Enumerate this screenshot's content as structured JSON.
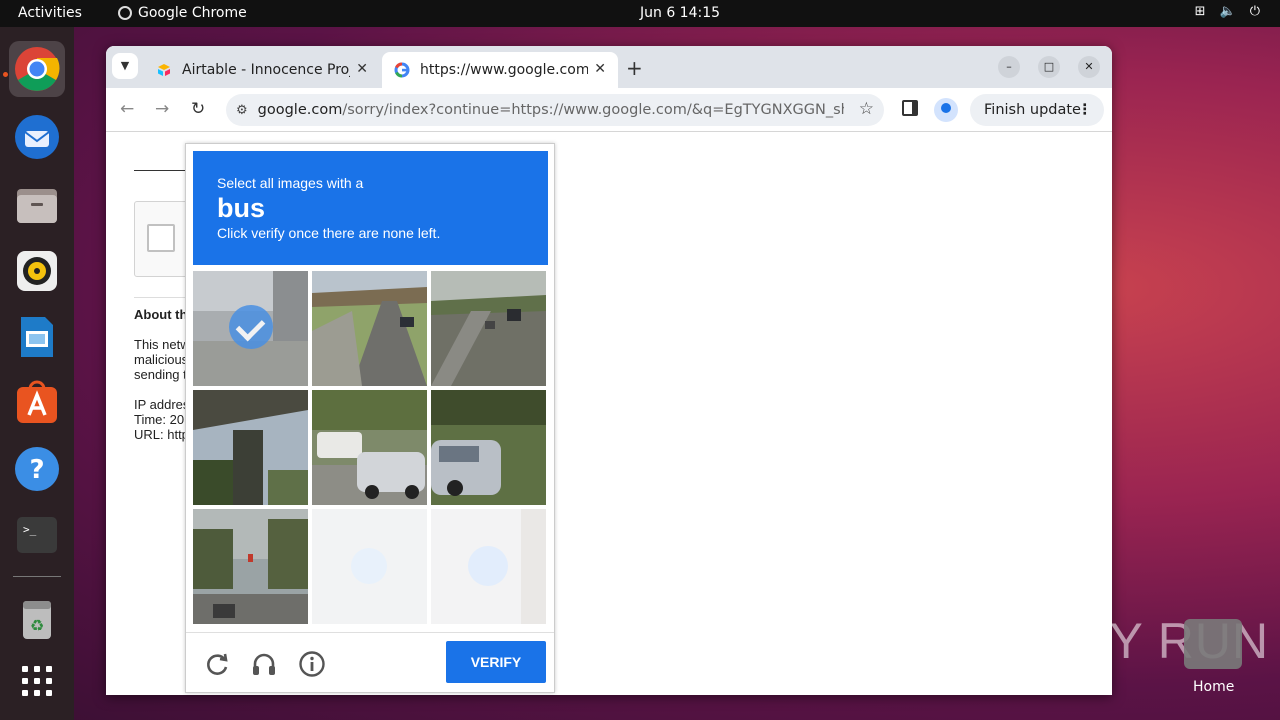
{
  "topbar": {
    "activities": "Activities",
    "app_name": "Google Chrome",
    "clock": "Jun 6  14:15"
  },
  "dock": {
    "items": [
      "chrome-icon",
      "thunderbird-icon",
      "files-icon",
      "rhythmbox-icon",
      "libreoffice-impress-icon",
      "app-center-icon",
      "help-icon",
      "terminal-icon",
      "trash-icon",
      "show-apps-icon"
    ]
  },
  "browser": {
    "tabs": [
      {
        "label": "Airtable - Innocence Proj"
      },
      {
        "label": "https://www.google.com"
      }
    ],
    "url_host": "google.com",
    "url_rest": "/sorry/index?continue=https://www.google.com/&q=EgTYGNXGGN_shrMGIjCZl...",
    "finish_update": "Finish update"
  },
  "page": {
    "about": "About th",
    "body1": "This netw",
    "body2": "malicious",
    "body3": "sending t",
    "ip": "IP addres",
    "time": "Time: 20",
    "url": "URL: http"
  },
  "captcha": {
    "line1": "Select all images with a",
    "target": "bus",
    "line3": "Click verify once there are none left.",
    "verify": "VERIFY",
    "tiles": [
      {
        "selected": true,
        "faded": false
      },
      {
        "selected": false,
        "faded": false
      },
      {
        "selected": false,
        "faded": false
      },
      {
        "selected": false,
        "faded": false
      },
      {
        "selected": false,
        "faded": false
      },
      {
        "selected": false,
        "faded": false
      },
      {
        "selected": false,
        "faded": false
      },
      {
        "selected": false,
        "faded": true
      },
      {
        "selected": true,
        "faded": true
      }
    ]
  },
  "desktop": {
    "watermark": "ANY RUN",
    "home_label": "Home"
  },
  "colors": {
    "accent": "#1a73e8",
    "ubuntu_orange": "#e95420"
  }
}
